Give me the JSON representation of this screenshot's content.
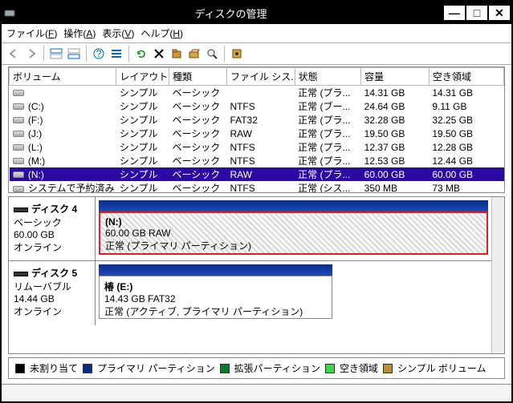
{
  "title": "ディスクの管理",
  "menus": {
    "file": "ファイル(F)",
    "action": "操作(A)",
    "view": "表示(V)",
    "help": "ヘルプ(H)"
  },
  "columns": {
    "volume": "ボリューム",
    "layout": "レイアウト",
    "type": "種類",
    "fs": "ファイル シス...",
    "status": "状態",
    "capacity": "容量",
    "free": "空き領域"
  },
  "rows": [
    {
      "label": "",
      "layout": "シンプル",
      "type": "ベーシック",
      "fs": "",
      "status": "正常 (プラ...",
      "capacity": "14.31 GB",
      "free": "14.31 GB",
      "sel": false
    },
    {
      "label": "(C:)",
      "layout": "シンプル",
      "type": "ベーシック",
      "fs": "NTFS",
      "status": "正常 (ブー...",
      "capacity": "24.64 GB",
      "free": "9.11 GB",
      "sel": false
    },
    {
      "label": "(F:)",
      "layout": "シンプル",
      "type": "ベーシック",
      "fs": "FAT32",
      "status": "正常 (プラ...",
      "capacity": "32.28 GB",
      "free": "32.25 GB",
      "sel": false
    },
    {
      "label": "(J:)",
      "layout": "シンプル",
      "type": "ベーシック",
      "fs": "RAW",
      "status": "正常 (プラ...",
      "capacity": "19.50 GB",
      "free": "19.50 GB",
      "sel": false
    },
    {
      "label": "(L:)",
      "layout": "シンプル",
      "type": "ベーシック",
      "fs": "NTFS",
      "status": "正常 (プラ...",
      "capacity": "12.37 GB",
      "free": "12.28 GB",
      "sel": false
    },
    {
      "label": "(M:)",
      "layout": "シンプル",
      "type": "ベーシック",
      "fs": "NTFS",
      "status": "正常 (プラ...",
      "capacity": "12.53 GB",
      "free": "12.44 GB",
      "sel": false
    },
    {
      "label": "(N:)",
      "layout": "シンプル",
      "type": "ベーシック",
      "fs": "RAW",
      "status": "正常 (プラ...",
      "capacity": "60.00 GB",
      "free": "60.00 GB",
      "sel": true
    },
    {
      "label": "システムで予約済み",
      "layout": "シンプル",
      "type": "ベーシック",
      "fs": "NTFS",
      "status": "正常 (シス...",
      "capacity": "350 MB",
      "free": "73 MB",
      "sel": false
    }
  ],
  "disk4": {
    "name": "ディスク 4",
    "type": "ベーシック",
    "size": "60.00 GB",
    "state": "オンライン",
    "part_label": "(N:)",
    "part_size": "60.00 GB RAW",
    "part_status": "正常 (プライマリ パーティション)"
  },
  "disk5": {
    "name": "ディスク 5",
    "type": "リムーバブル",
    "size": "14.44 GB",
    "state": "オンライン",
    "part_label": "椿   (E:)",
    "part_size": "14.43 GB FAT32",
    "part_status": "正常 (アクティブ, プライマリ パーティション)"
  },
  "legend": {
    "unalloc": "未割り当て",
    "primary": "プライマリ パーティション",
    "extended": "拡張パーティション",
    "free": "空き領域",
    "simple": "シンプル ボリューム"
  },
  "colors": {
    "primary": "#0a2a8a",
    "extended": "#0a7a2a",
    "free": "#3bd84a",
    "simple": "#b89030",
    "unalloc": "#000000"
  }
}
